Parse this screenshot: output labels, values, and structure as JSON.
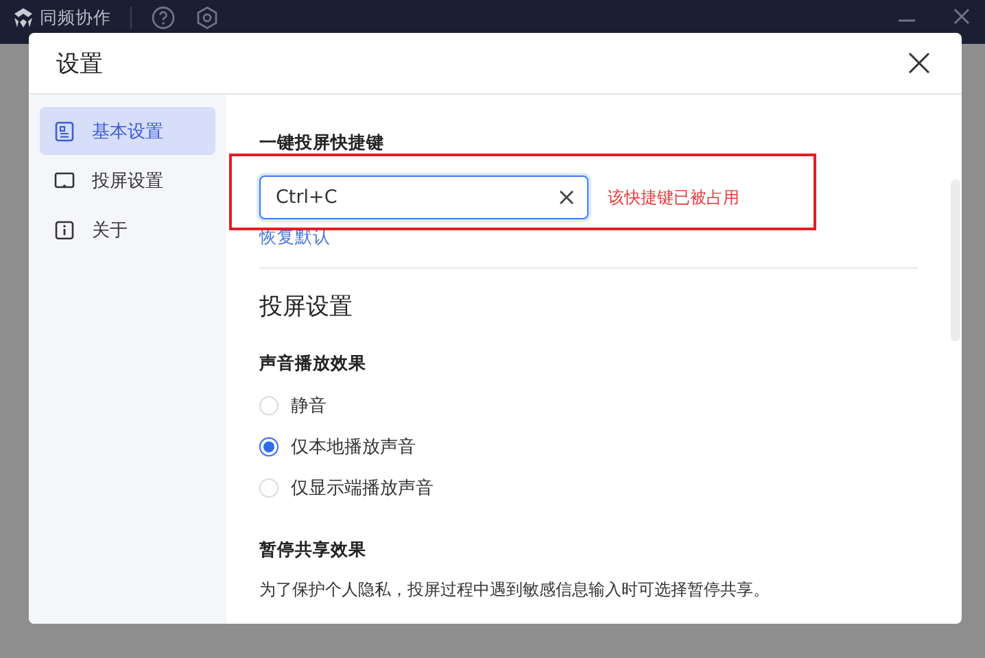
{
  "app_bar": {
    "title": "同频协作"
  },
  "dialog": {
    "title": "设置",
    "sidebar": {
      "items": [
        {
          "label": "基本设置",
          "selected": true
        },
        {
          "label": "投屏设置",
          "selected": false
        },
        {
          "label": "关于",
          "selected": false
        }
      ]
    },
    "shortcut": {
      "label": "一键投屏快捷键",
      "value": "Ctrl+C",
      "error": "该快捷键已被占用",
      "highlighted": true,
      "reset_link": "恢复默认"
    },
    "section_title": "投屏设置",
    "sound": {
      "label": "声音播放效果",
      "options": [
        {
          "label": "静音",
          "selected": false
        },
        {
          "label": "仅本地播放声音",
          "selected": true
        },
        {
          "label": "仅显示端播放声音",
          "selected": false
        }
      ]
    },
    "pause": {
      "label": "暂停共享效果",
      "description": "为了保护个人隐私，投屏过程中遇到敏感信息输入时可选择暂停共享。"
    }
  }
}
